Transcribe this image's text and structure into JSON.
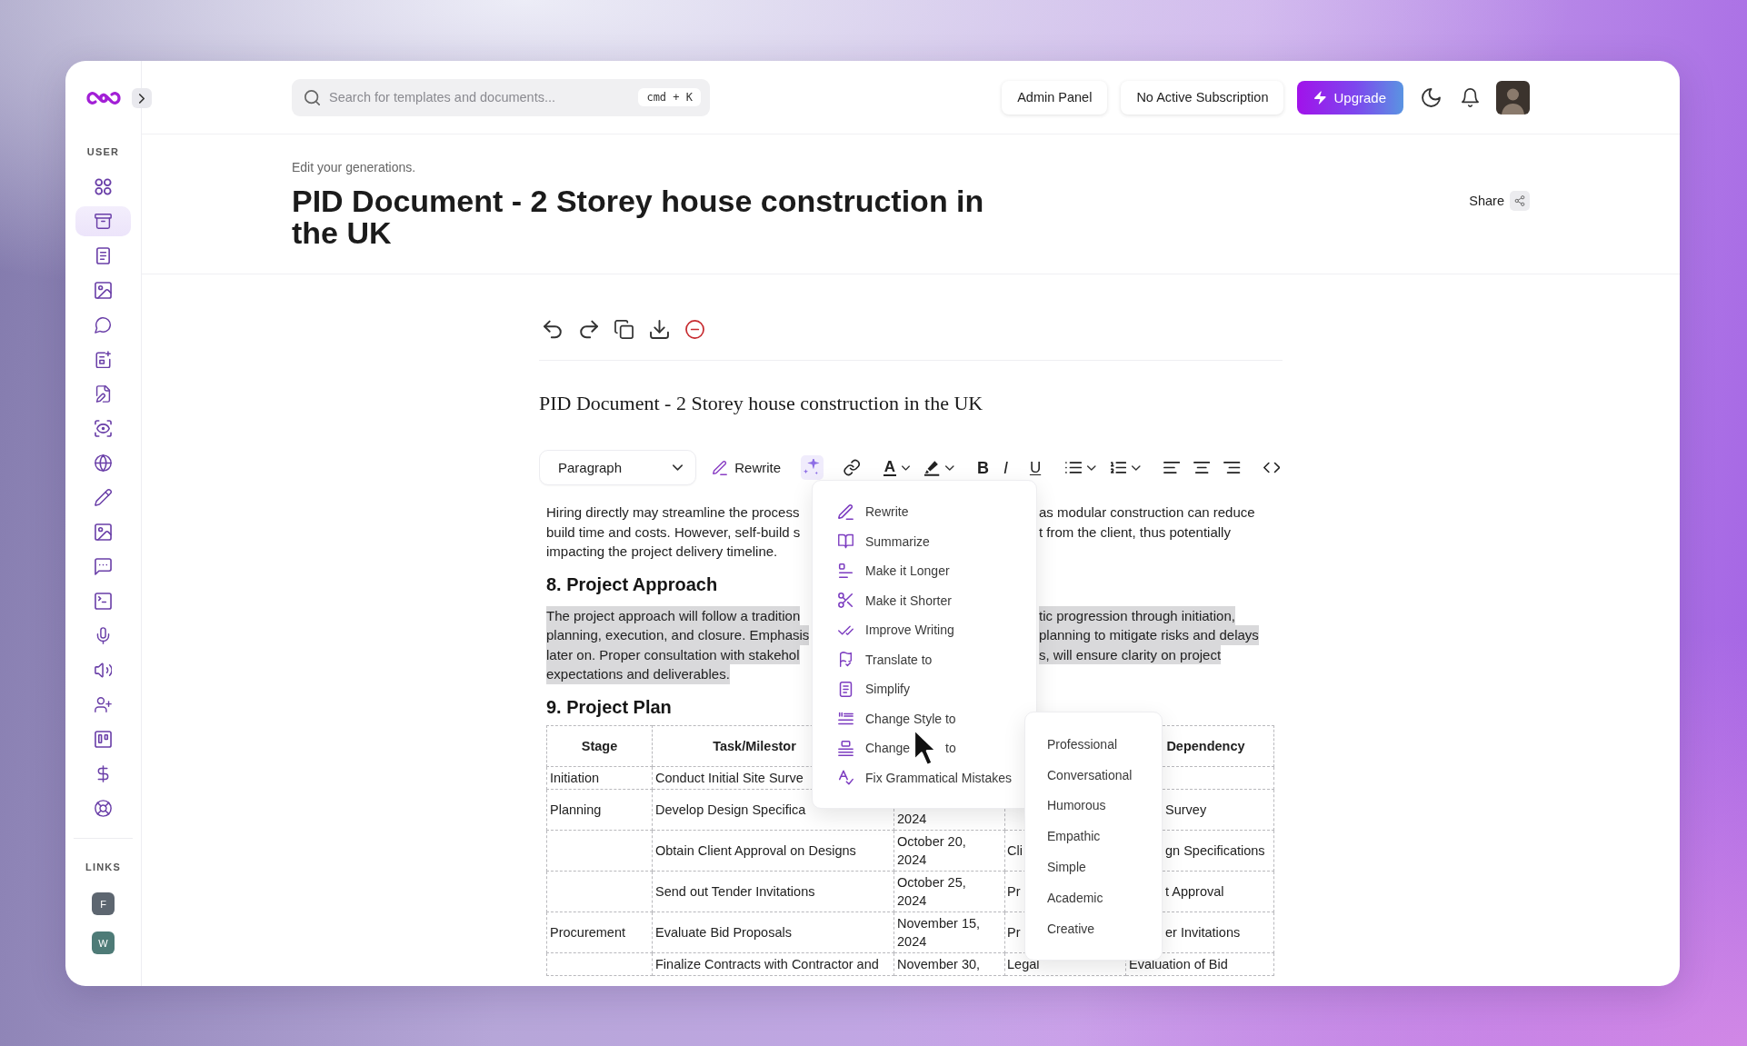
{
  "sidebar": {
    "section_label": "USER",
    "items": [
      {
        "selected": false
      },
      {
        "selected": true
      },
      {
        "selected": false
      },
      {
        "selected": false
      },
      {
        "selected": false
      },
      {
        "selected": false
      },
      {
        "selected": false
      },
      {
        "selected": false
      },
      {
        "selected": false
      },
      {
        "selected": false
      },
      {
        "selected": false
      },
      {
        "selected": false
      },
      {
        "selected": false
      },
      {
        "selected": false
      },
      {
        "selected": false
      },
      {
        "selected": false
      },
      {
        "selected": false
      },
      {
        "selected": false
      },
      {
        "selected": false
      }
    ],
    "links_label": "LINKS",
    "links": [
      {
        "letter": "F",
        "color": "#5d6670"
      },
      {
        "letter": "W",
        "color": "#4e7b77"
      }
    ]
  },
  "topbar": {
    "search": {
      "placeholder": "Search for templates and documents...",
      "shortcut": "cmd + K"
    },
    "buttons": [
      "Admin Panel",
      "No Active Subscription"
    ],
    "upgrade": "Upgrade"
  },
  "header": {
    "subtitle": "Edit your generations.",
    "title": "PID Document - 2 Storey house construction in the UK",
    "share": "Share"
  },
  "editor": {
    "document_title": "PID Document - 2 Storey house construction in the UK",
    "toolbar": {
      "block_type": "Paragraph",
      "rewrite": "Rewrite",
      "tools": [
        {
          "kind": "ai",
          "active": true,
          "dropdown": false
        },
        {
          "kind": "link",
          "active": false,
          "dropdown": false
        },
        {
          "kind": "text_color",
          "glyph": "A",
          "active": false,
          "dropdown": true
        },
        {
          "kind": "highlight",
          "active": false,
          "dropdown": true
        },
        {
          "kind": "bold",
          "glyph": "B",
          "active": false,
          "dropdown": false
        },
        {
          "kind": "italic",
          "glyph": "I",
          "active": false,
          "dropdown": false
        },
        {
          "kind": "underline",
          "glyph": "U",
          "active": false,
          "dropdown": false
        },
        {
          "kind": "bullet_list",
          "active": false,
          "dropdown": true
        },
        {
          "kind": "ordered_list",
          "active": false,
          "dropdown": true
        },
        {
          "kind": "align_left",
          "active": false,
          "dropdown": false
        },
        {
          "kind": "align_center",
          "active": false,
          "dropdown": false
        },
        {
          "kind": "align_right",
          "active": false,
          "dropdown": false
        },
        {
          "kind": "code",
          "active": false,
          "dropdown": false
        }
      ]
    },
    "content": [
      {
        "kind": "paragraph",
        "selected": false,
        "lines": [
          [
            "Hiring directly may streamline the process",
            "as modular construction can reduce"
          ],
          [
            "build time and costs. However, self-build s",
            "t from the client, thus potentially"
          ],
          [
            "impacting the project delivery timeline."
          ]
        ]
      },
      {
        "kind": "heading",
        "text": "8. Project Approach"
      },
      {
        "kind": "paragraph",
        "selected": true,
        "lines": [
          [
            "The project approach will follow a tradition",
            "tic progression through initiation,"
          ],
          [
            "planning, execution, and closure. Emphasis",
            "planning to mitigate risks and delays"
          ],
          [
            "later on. Proper consultation with stakehol",
            "s, will ensure clarity on project"
          ],
          [
            "expectations and deliverables."
          ]
        ]
      },
      {
        "kind": "heading",
        "text": "9. Project Plan"
      },
      {
        "kind": "table",
        "header": {
          "stage": "Stage",
          "task": "Task/Milestor",
          "dependency": "Dependency"
        },
        "rows": [
          {
            "stage": "Initiation",
            "task": "Conduct Initial Site Surve"
          },
          {
            "stage": "Planning",
            "task": "Develop Design Specifica",
            "column_3": "2024",
            "dependency": "Survey"
          },
          {
            "task": "Obtain Client Approval on Designs",
            "column_3": "October 20, 2024",
            "column_4": "Cli",
            "dependency": "gn Specifications"
          },
          {
            "task": "Send out Tender Invitations",
            "column_3": "October 25, 2024",
            "column_4": "Pr",
            "dependency": "t Approval"
          },
          {
            "stage": "Procurement",
            "task": "Evaluate Bid Proposals",
            "column_3": "November 15, 2024",
            "column_4": "Pr",
            "dependency": "er Invitations"
          },
          {
            "task": "Finalize Contracts with Contractor and",
            "column_3": "November 30,",
            "column_4": "Legal",
            "dependency": "Evaluation of Bid"
          }
        ]
      }
    ]
  },
  "ai_menu": {
    "items": [
      {
        "label": "Rewrite"
      },
      {
        "label": "Summarize"
      },
      {
        "label": "Make it Longer"
      },
      {
        "label": "Make it Shorter"
      },
      {
        "label": "Improve Writing"
      },
      {
        "label": "Translate to"
      },
      {
        "label": "Simplify"
      },
      {
        "label": "Change Style to"
      },
      {
        "label": "Change",
        "label_end": "to"
      },
      {
        "label": "Fix Grammatical Mistakes"
      }
    ]
  },
  "style_submenu": {
    "items": [
      "Professional",
      "Conversational",
      "Humorous",
      "Empathic",
      "Simple",
      "Academic",
      "Creative"
    ]
  }
}
